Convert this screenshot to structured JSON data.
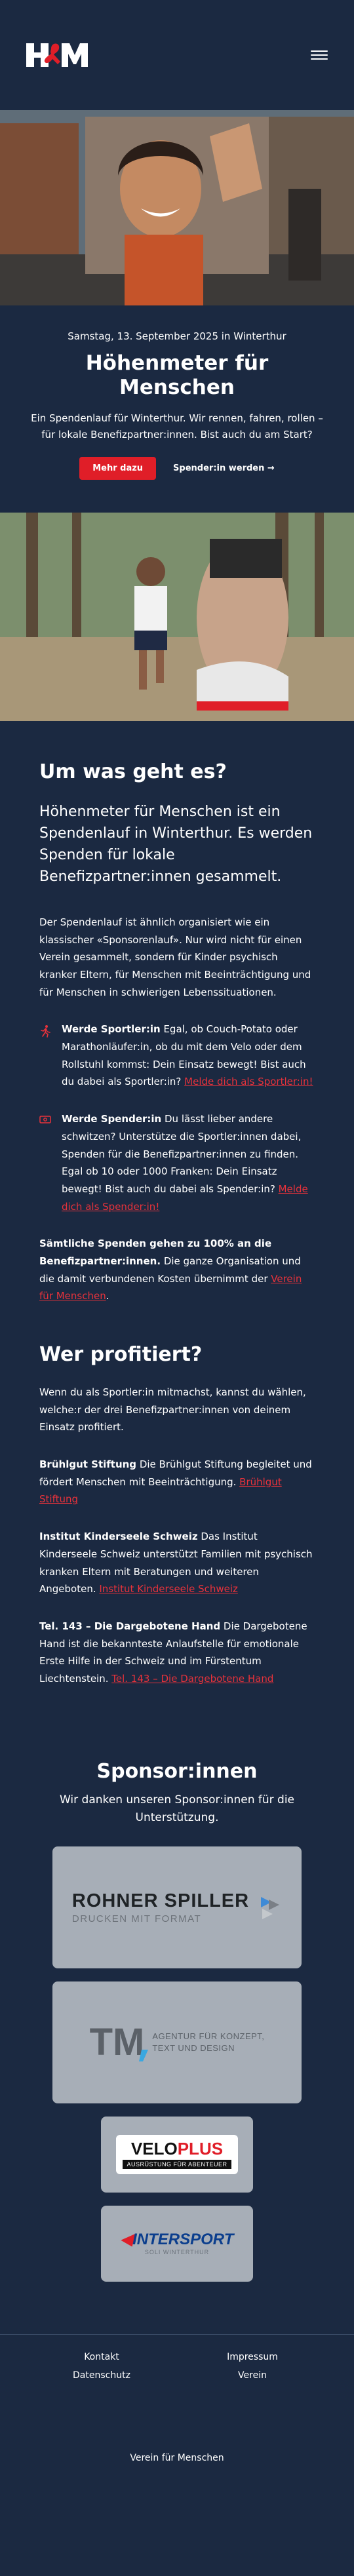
{
  "header": {
    "logo_text": "H&M",
    "menu_icon": "hamburger-menu-icon"
  },
  "hero": {
    "date": "Samstag, 13. September 2025 in Winterthur",
    "title": "Höhenmeter für Menschen",
    "lead": "Ein Spendenlauf für Winterthur. Wir rennen, fahren, rollen – für lokale Benefizpartner:innen. Bist auch du am Start?",
    "primary_button": "Mehr dazu",
    "secondary_link": "Spender:in werden →"
  },
  "about": {
    "heading": "Um was geht es?",
    "intro": "Höhenmeter für Menschen ist ein Spendenlauf in Winterthur. Es werden Spenden für lokale Benefizpartner:innen gesammelt.",
    "paragraph": "Der Spendenlauf ist ähnlich organisiert wie ein klassischer «Sponsorenlauf». Nur wird nicht für einen Verein gesammelt, sondern für Kinder psychisch kranker Eltern, für Menschen mit Beeinträchtigung und für Menschen in schwierigen Lebenssituationen.",
    "features": [
      {
        "icon": "runner-icon",
        "title": "Werde Sportler:in",
        "text": " Egal, ob Couch-Potato oder Marathonläufer:in, ob du mit dem Velo oder dem Rollstuhl kommst: Dein Einsatz bewegt! Bist auch du dabei als Sportler:in? ",
        "link": "Melde dich als Sportler:in!"
      },
      {
        "icon": "money-icon",
        "title": "Werde Spender:in",
        "text": " Du lässt lieber andere schwitzen? Unterstütze die Sportler:innen dabei, Spenden für die Benefizpartner:innen zu finden. Egal ob 10 oder 1000 Franken: Dein Einsatz bewegt! Bist auch du dabei als Spender:in? ",
        "link": "Melde dich als Spender:in!"
      }
    ],
    "note_bold": "Sämtliche Spenden gehen zu 100% an die Benefizpartner:innen.",
    "note_text": " Die ganze Organisation und die damit verbundenen Kosten übernimmt der ",
    "note_link": "Verein für Menschen",
    "note_end": "."
  },
  "beneficiaries": {
    "heading": "Wer profitiert?",
    "intro": "Wenn du als Sportler:in mitmachst, kannst du wählen, welche:r der drei Benefizpartner:innen von deinem Einsatz profitiert.",
    "items": [
      {
        "name": "Brühlgut Stiftung",
        "text": " Die Brühlgut Stiftung begleitet und fördert Menschen mit Beeinträchtigung. ",
        "link": "Brühlgut Stiftung"
      },
      {
        "name": "Institut Kinderseele Schweiz",
        "text": " Das Institut Kinderseele Schweiz unterstützt Familien mit psychisch kranken Eltern mit Beratungen und weiteren Angeboten. ",
        "link": "Institut Kinderseele Schweiz"
      },
      {
        "name": "Tel. 143 – Die Dargebotene Hand",
        "text": " Die Dargebotene Hand ist die bekannteste Anlaufstelle für emotionale Erste Hilfe in der Schweiz und im Fürstentum Liechtenstein. ",
        "link": "Tel. 143 – Die Dargebotene Hand"
      }
    ]
  },
  "sponsors": {
    "heading": "Sponsor:innen",
    "lead": "Wir danken unseren Sponsor:innen für die Unterstützung.",
    "rohner": {
      "name": "ROHNER SPILLER",
      "tagline": "DRUCKEN MIT FORMAT"
    },
    "tm": {
      "mark": "TM",
      "line1": "AGENTUR FÜR KONZEPT,",
      "line2": "TEXT UND DESIGN"
    },
    "velo": {
      "name_a": "VELO",
      "name_b": "PLUS",
      "tagline": "AUSRÜSTUNG FÜR ABENTEUER"
    },
    "intersport": {
      "name_a": "INTER",
      "name_b": "SPORT",
      "sub": "SOLI WINTERTHUR"
    }
  },
  "footer": {
    "links": [
      "Kontakt",
      "Impressum",
      "Datenschutz",
      "Verein"
    ],
    "bottom": "Verein für Menschen"
  },
  "colors": {
    "background": "#1b2941",
    "accent": "#e01e28",
    "link": "#e8323b",
    "card": "#a7aeb7"
  }
}
